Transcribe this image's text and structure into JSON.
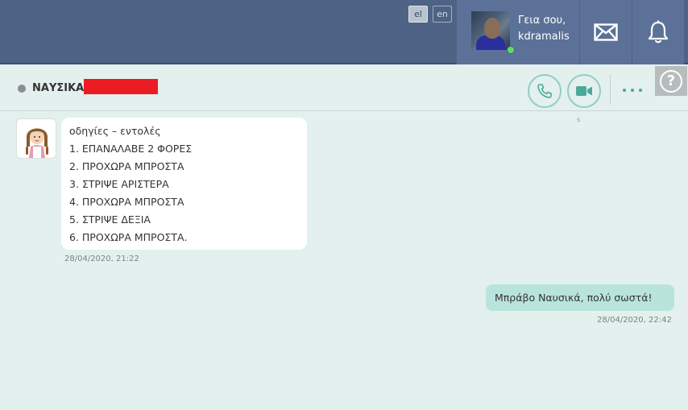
{
  "header": {
    "languages": [
      {
        "code": "el",
        "active": true
      },
      {
        "code": "en",
        "active": false
      }
    ],
    "greeting_line1": "Γεια σου,",
    "greeting_line2": "kdramalis",
    "icons": [
      "mail-icon",
      "bell-icon"
    ]
  },
  "chat": {
    "contact_name": "ΝΑΥΣΙΚΑ",
    "help_label": "?",
    "video_hint": "s",
    "messages": [
      {
        "direction": "incoming",
        "lines": [
          "οδηγίες – εντολές",
          "1. ΕΠΑΝΑΛΑΒΕ 2 ΦΟΡΕΣ",
          "2. ΠΡΟΧΩΡΑ ΜΠΡΟΣΤΑ",
          "3. ΣΤΡΙΨΕ ΑΡΙΣΤΕΡΑ",
          "4. ΠΡΟΧΩΡΑ ΜΠΡΟΣΤΑ",
          "5. ΣΤΡΙΨΕ ΔΕΞΙΑ",
          "6. ΠΡΟΧΩΡΑ ΜΠΡΟΣΤΑ."
        ],
        "timestamp": "28/04/2020, 21:22"
      },
      {
        "direction": "outgoing",
        "text": "Μπράβο Ναυσικά, πολύ σωστά!",
        "timestamp": "28/04/2020, 22:42"
      }
    ]
  },
  "colors": {
    "topbar": "#4e6385",
    "accent": "#4aa99a",
    "outgoing_bubble": "#b9e4dc",
    "background": "#e4f0ee",
    "redaction": "#ec1c24"
  }
}
